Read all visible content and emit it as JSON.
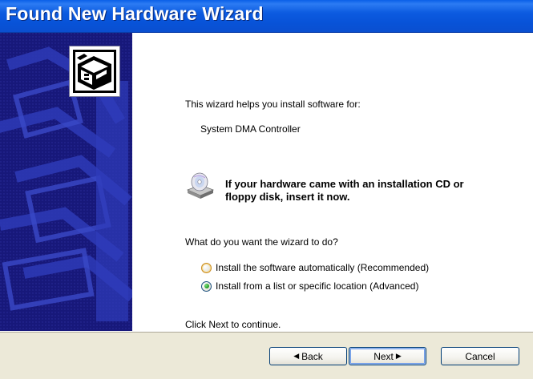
{
  "window": {
    "title": "Found New Hardware Wizard"
  },
  "content": {
    "intro": "This wizard helps you install software for:",
    "device_name": "System DMA Controller",
    "cd_notice": "If your hardware came with an installation CD or floppy disk, insert it now.",
    "question": "What do you want the wizard to do?",
    "options": [
      {
        "label": "Install the software automatically (Recommended)",
        "selected": false
      },
      {
        "label": "Install from a list or specific location (Advanced)",
        "selected": true
      }
    ],
    "footer_hint": "Click Next to continue."
  },
  "buttons": {
    "back": "Back",
    "back_arrow": "◀",
    "next": "Next",
    "next_arrow": "▶",
    "cancel": "Cancel"
  },
  "icons": {
    "hardware": "hardware-chip-icon",
    "cd": "cd-drive-icon"
  },
  "colors": {
    "titlebar": "#0A55DC",
    "side_panel": "#17187A",
    "content_bg": "#FFFFFF",
    "dialog_bg": "#ECE9D8",
    "radio_selected": "#2AA12A"
  }
}
